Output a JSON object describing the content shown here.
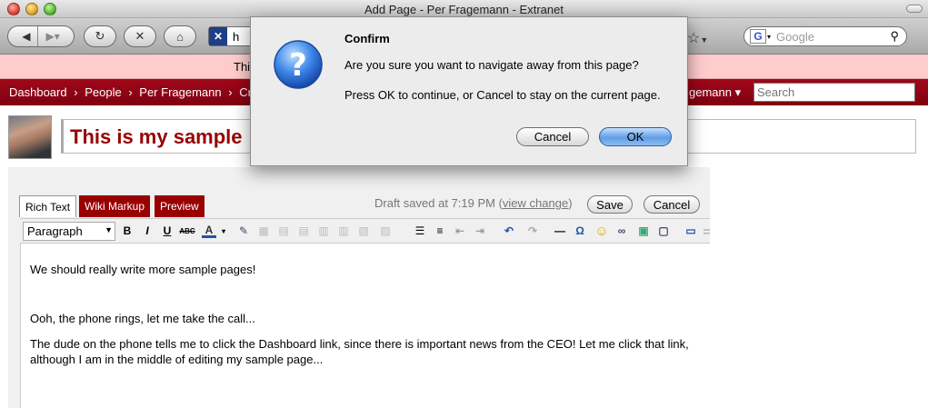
{
  "window": {
    "title": "Add Page - Per Fragemann - Extranet"
  },
  "browser": {
    "url_fragment": "h",
    "search_placeholder": "Google"
  },
  "banner": {
    "text": "This"
  },
  "nav": {
    "crumbs": [
      "Dashboard",
      "›",
      "People",
      "›",
      "Per Fragemann",
      "›",
      "Cr"
    ],
    "user_label": "gemann ▾",
    "search_placeholder": "Search"
  },
  "page": {
    "title_value": "This is my sample"
  },
  "editor": {
    "tabs": [
      "Rich Text",
      "Wiki Markup",
      "Preview"
    ],
    "draft_text": "Draft saved at 7:19 PM (",
    "draft_link": "view change",
    "draft_close": ")",
    "save_label": "Save",
    "cancel_label": "Cancel",
    "format_value": "Paragraph",
    "content": [
      "We should really write more sample pages!",
      "Ooh, the phone rings, let me take the call...",
      "The dude on the phone tells me to click the Dashboard link, since there is important news from the CEO! Let me click that link, although I am in the middle of editing my sample page..."
    ]
  },
  "dialog": {
    "title": "Confirm",
    "message": "Are you sure you want to navigate away from this page?",
    "detail": "Press OK to continue, or Cancel to stay on the current page.",
    "cancel_label": "Cancel",
    "ok_label": "OK"
  },
  "colors": {
    "nav": "#990000",
    "banner": "#ffcccc",
    "title": "#990000",
    "ok_button": "#5f9de6"
  }
}
